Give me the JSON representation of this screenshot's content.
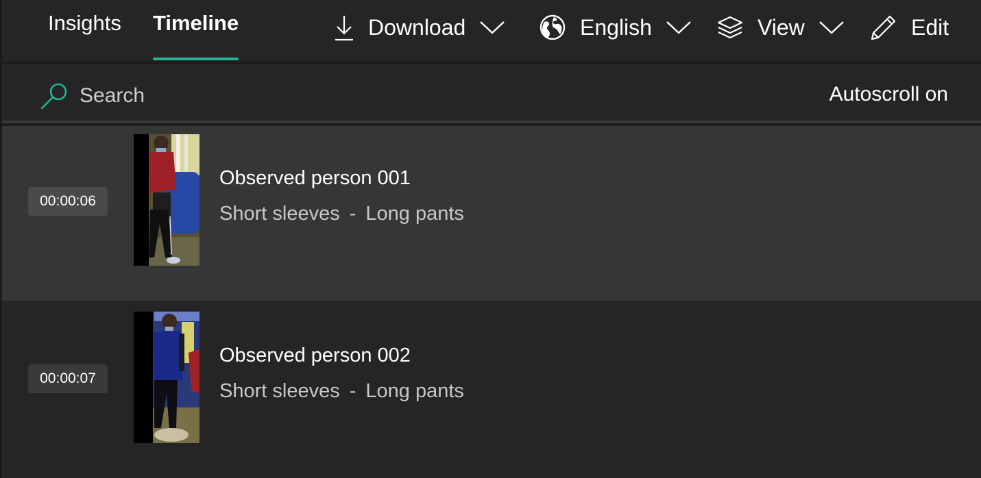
{
  "tabs": [
    {
      "label": "Insights",
      "active": false
    },
    {
      "label": "Timeline",
      "active": true
    }
  ],
  "toolbar": {
    "download": {
      "label": "Download",
      "icon": "download-icon"
    },
    "language": {
      "label": "English",
      "icon": "globe-icon"
    },
    "view": {
      "label": "View",
      "icon": "layers-icon"
    },
    "edit": {
      "label": "Edit",
      "icon": "pencil-icon"
    }
  },
  "search": {
    "placeholder": "Search",
    "value": ""
  },
  "autoscroll": {
    "label": "Autoscroll on"
  },
  "colors": {
    "accent": "#1fb493",
    "background": "#252525",
    "row_highlight": "#363636"
  },
  "items": [
    {
      "timestamp": "00:00:06",
      "title": "Observed person 001",
      "attributes": [
        "Short sleeves",
        "Long pants"
      ],
      "separator": "-",
      "selected": true
    },
    {
      "timestamp": "00:00:07",
      "title": "Observed person 002",
      "attributes": [
        "Short sleeves",
        "Long pants"
      ],
      "separator": "-",
      "selected": false
    }
  ]
}
